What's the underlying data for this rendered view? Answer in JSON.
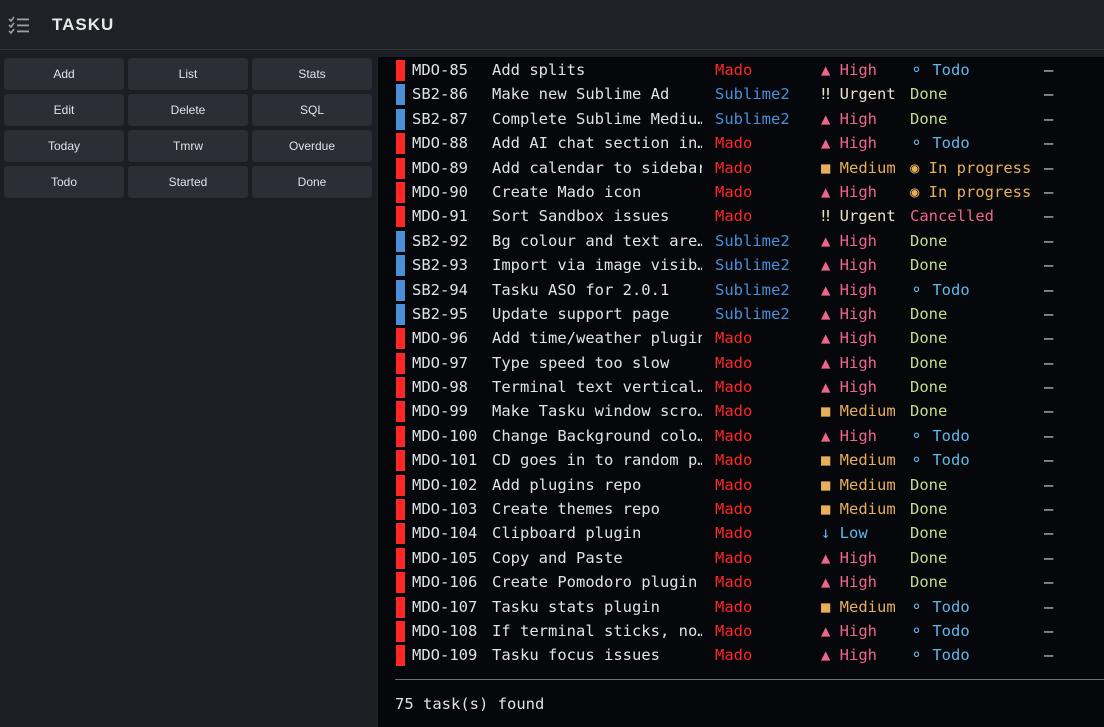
{
  "app": {
    "title": "TASKU",
    "icon": "checklist-icon"
  },
  "buttons": [
    {
      "label": "Add"
    },
    {
      "label": "List"
    },
    {
      "label": "Stats"
    },
    {
      "label": "Edit"
    },
    {
      "label": "Delete"
    },
    {
      "label": "SQL"
    },
    {
      "label": "Today"
    },
    {
      "label": "Tmrw"
    },
    {
      "label": "Overdue"
    },
    {
      "label": "Todo"
    },
    {
      "label": "Started"
    },
    {
      "label": "Done"
    }
  ],
  "colors": {
    "mado": "#ff2626",
    "sublime2": "#4a8fd8",
    "high": "#f0658c",
    "urgent": "#e9e1c8",
    "medium": "#e8ae5a",
    "low": "#5fb8ea",
    "todo": "#5fb8ea",
    "done": "#c3dd8b",
    "in_progress": "#e8ae5a",
    "cancelled": "#f0658c"
  },
  "tasks": [
    {
      "id": "MDO-85",
      "title": "Add splits",
      "project": "Mado",
      "priority": "▲ High",
      "pri": "high",
      "status": "⚬ Todo",
      "st": "todo",
      "due": "—"
    },
    {
      "id": "SB2-86",
      "title": "Make new Sublime Ad",
      "project": "Sublime2",
      "priority": "‼ Urgent",
      "pri": "urgent",
      "status": "  Done",
      "st": "done",
      "due": "—"
    },
    {
      "id": "SB2-87",
      "title": "Complete Sublime Mediu…",
      "project": "Sublime2",
      "priority": "▲ High",
      "pri": "high",
      "status": "  Done",
      "st": "done",
      "due": "—"
    },
    {
      "id": "MDO-88",
      "title": "Add AI chat section in…",
      "project": "Mado",
      "priority": "▲ High",
      "pri": "high",
      "status": "⚬ Todo",
      "st": "todo",
      "due": "—"
    },
    {
      "id": "MDO-89",
      "title": "Add calendar to sidebar",
      "project": "Mado",
      "priority": "■ Medium",
      "pri": "medium",
      "status": "◉ In progress",
      "st": "in_progress",
      "due": "—"
    },
    {
      "id": "MDO-90",
      "title": "Create Mado icon",
      "project": "Mado",
      "priority": "▲ High",
      "pri": "high",
      "status": "◉ In progress",
      "st": "in_progress",
      "due": "—"
    },
    {
      "id": "MDO-91",
      "title": "Sort Sandbox issues",
      "project": "Mado",
      "priority": "‼ Urgent",
      "pri": "urgent",
      "status": "  Cancelled",
      "st": "cancelled",
      "due": "—"
    },
    {
      "id": "SB2-92",
      "title": "Bg colour and text are…",
      "project": "Sublime2",
      "priority": "▲ High",
      "pri": "high",
      "status": "  Done",
      "st": "done",
      "due": "—"
    },
    {
      "id": "SB2-93",
      "title": "Import via image visib…",
      "project": "Sublime2",
      "priority": "▲ High",
      "pri": "high",
      "status": "  Done",
      "st": "done",
      "due": "—"
    },
    {
      "id": "SB2-94",
      "title": "Tasku ASO for 2.0.1",
      "project": "Sublime2",
      "priority": "▲ High",
      "pri": "high",
      "status": "⚬ Todo",
      "st": "todo",
      "due": "—"
    },
    {
      "id": "SB2-95",
      "title": "Update support page",
      "project": "Sublime2",
      "priority": "▲ High",
      "pri": "high",
      "status": "  Done",
      "st": "done",
      "due": "—"
    },
    {
      "id": "MDO-96",
      "title": "Add time/weather plugin",
      "project": "Mado",
      "priority": "▲ High",
      "pri": "high",
      "status": "  Done",
      "st": "done",
      "due": "—"
    },
    {
      "id": "MDO-97",
      "title": "Type speed too slow",
      "project": "Mado",
      "priority": "▲ High",
      "pri": "high",
      "status": "  Done",
      "st": "done",
      "due": "—"
    },
    {
      "id": "MDO-98",
      "title": "Terminal text vertical…",
      "project": "Mado",
      "priority": "▲ High",
      "pri": "high",
      "status": "  Done",
      "st": "done",
      "due": "—"
    },
    {
      "id": "MDO-99",
      "title": "Make Tasku window scro…",
      "project": "Mado",
      "priority": "■ Medium",
      "pri": "medium",
      "status": "  Done",
      "st": "done",
      "due": "—"
    },
    {
      "id": "MDO-100",
      "title": "Change Background colo…",
      "project": "Mado",
      "priority": "▲ High",
      "pri": "high",
      "status": "⚬ Todo",
      "st": "todo",
      "due": "—"
    },
    {
      "id": "MDO-101",
      "title": "CD goes in to random p…",
      "project": "Mado",
      "priority": "■ Medium",
      "pri": "medium",
      "status": "⚬ Todo",
      "st": "todo",
      "due": "—"
    },
    {
      "id": "MDO-102",
      "title": "Add plugins repo",
      "project": "Mado",
      "priority": "■ Medium",
      "pri": "medium",
      "status": "  Done",
      "st": "done",
      "due": "—"
    },
    {
      "id": "MDO-103",
      "title": "Create themes repo",
      "project": "Mado",
      "priority": "■ Medium",
      "pri": "medium",
      "status": "  Done",
      "st": "done",
      "due": "—"
    },
    {
      "id": "MDO-104",
      "title": "Clipboard plugin",
      "project": "Mado",
      "priority": "↓ Low",
      "pri": "low",
      "status": "  Done",
      "st": "done",
      "due": "—"
    },
    {
      "id": "MDO-105",
      "title": "Copy and Paste",
      "project": "Mado",
      "priority": "▲ High",
      "pri": "high",
      "status": "  Done",
      "st": "done",
      "due": "—"
    },
    {
      "id": "MDO-106",
      "title": "Create Pomodoro plugin",
      "project": "Mado",
      "priority": "▲ High",
      "pri": "high",
      "status": "  Done",
      "st": "done",
      "due": "—"
    },
    {
      "id": "MDO-107",
      "title": "Tasku stats plugin",
      "project": "Mado",
      "priority": "■ Medium",
      "pri": "medium",
      "status": "⚬ Todo",
      "st": "todo",
      "due": "—"
    },
    {
      "id": "MDO-108",
      "title": "If terminal sticks, no…",
      "project": "Mado",
      "priority": "▲ High",
      "pri": "high",
      "status": "⚬ Todo",
      "st": "todo",
      "due": "—"
    },
    {
      "id": "MDO-109",
      "title": "Tasku focus issues",
      "project": "Mado",
      "priority": "▲ High",
      "pri": "high",
      "status": "⚬ Todo",
      "st": "todo",
      "due": "—"
    }
  ],
  "footer": "75 task(s) found"
}
